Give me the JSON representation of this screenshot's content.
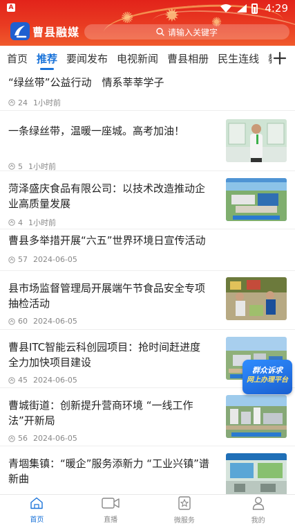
{
  "status_bar": {
    "time": "4:29",
    "app_icon": "A"
  },
  "header": {
    "app_name": "曹县融媒",
    "search_placeholder": "请输入关键字"
  },
  "tabs": [
    {
      "label": "首页",
      "active": false
    },
    {
      "label": "推荐",
      "active": true
    },
    {
      "label": "要闻发布",
      "active": false
    },
    {
      "label": "电视新闻",
      "active": false
    },
    {
      "label": "曹县相册",
      "active": false
    },
    {
      "label": "民生连线",
      "active": false
    },
    {
      "label": "教",
      "active": false
    }
  ],
  "feed": [
    {
      "title": "“绿丝带”公益行动　情系莘莘学子",
      "views": "24",
      "time": "1小时前",
      "has_image": false
    },
    {
      "title": "一条绿丝带，温暖一座城。高考加油！",
      "views": "5",
      "time": "1小时前",
      "has_image": true,
      "image_desc": "person-with-green-ribbon"
    },
    {
      "title": "菏泽盛庆食品有限公司：以技术改造推动企业高质量发展",
      "views": "4",
      "time": "1小时前",
      "has_image": true,
      "image_desc": "factory-aerial"
    },
    {
      "title": "曹县多举措开展“六五”世界环境日宣传活动",
      "views": "57",
      "time": "2024-06-05",
      "has_image": false
    },
    {
      "title": "县市场监督管理局开展端午节食品安全专项抽检活动",
      "views": "60",
      "time": "2024-06-05",
      "has_image": true,
      "image_desc": "market-inspection"
    },
    {
      "title": "曹县ITC智能云科创园项目：抢时间赶进度 全力加快项目建设",
      "views": "45",
      "time": "2024-06-05",
      "has_image": true,
      "image_desc": "construction-aerial"
    },
    {
      "title": "曹城街道：创新提升营商环境 “一线工作法”开新局",
      "views": "56",
      "time": "2024-06-05",
      "has_image": true,
      "image_desc": "city-aerial"
    },
    {
      "title": "青堌集镇：“暖企”服务添新力 “工业兴镇”谱新曲",
      "views": "",
      "time": "",
      "has_image": true,
      "image_desc": "exhibition-hall"
    }
  ],
  "float_badge": {
    "line1": "群众诉求",
    "line2": "网上办理平台"
  },
  "bottom_nav": [
    {
      "label": "首页",
      "icon": "home-icon",
      "active": true
    },
    {
      "label": "直播",
      "icon": "video-icon",
      "active": false
    },
    {
      "label": "微服务",
      "icon": "star-bookmark-icon",
      "active": false
    },
    {
      "label": "我的",
      "icon": "user-icon",
      "active": false
    }
  ],
  "colors": {
    "header_red": "#e2231a",
    "accent_blue": "#1a73d9",
    "meta_gray": "#888888"
  }
}
